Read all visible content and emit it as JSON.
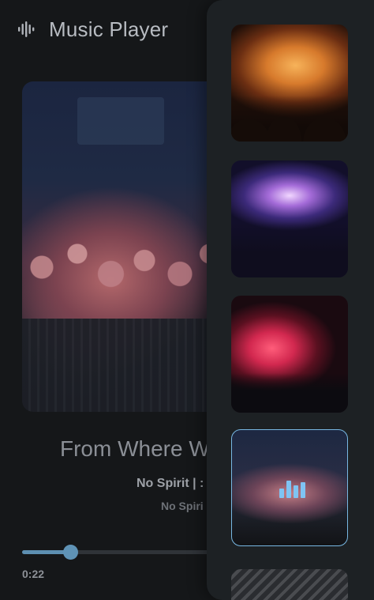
{
  "header": {
    "title": "Music Player",
    "logo_icon": "sound-wave-icon"
  },
  "now_playing": {
    "title": "From Where W",
    "artist": "No Spirit | :",
    "album": "No Spiri",
    "elapsed": "0:22",
    "progress": 0.17
  },
  "queue": {
    "items": [
      {
        "label": "concert-orange-lights",
        "active": false
      },
      {
        "label": "concert-purple-screens",
        "active": false
      },
      {
        "label": "concert-red-smoke",
        "active": false
      },
      {
        "label": "concert-crowd",
        "active": true,
        "indicator_icon": "equalizer-icon"
      },
      {
        "label": "concert-stage-lights",
        "active": false
      }
    ]
  },
  "colors": {
    "accent": "#5f93b6",
    "active_border": "#78b8e3",
    "background": "#151719",
    "drawer": "#1d2124"
  }
}
